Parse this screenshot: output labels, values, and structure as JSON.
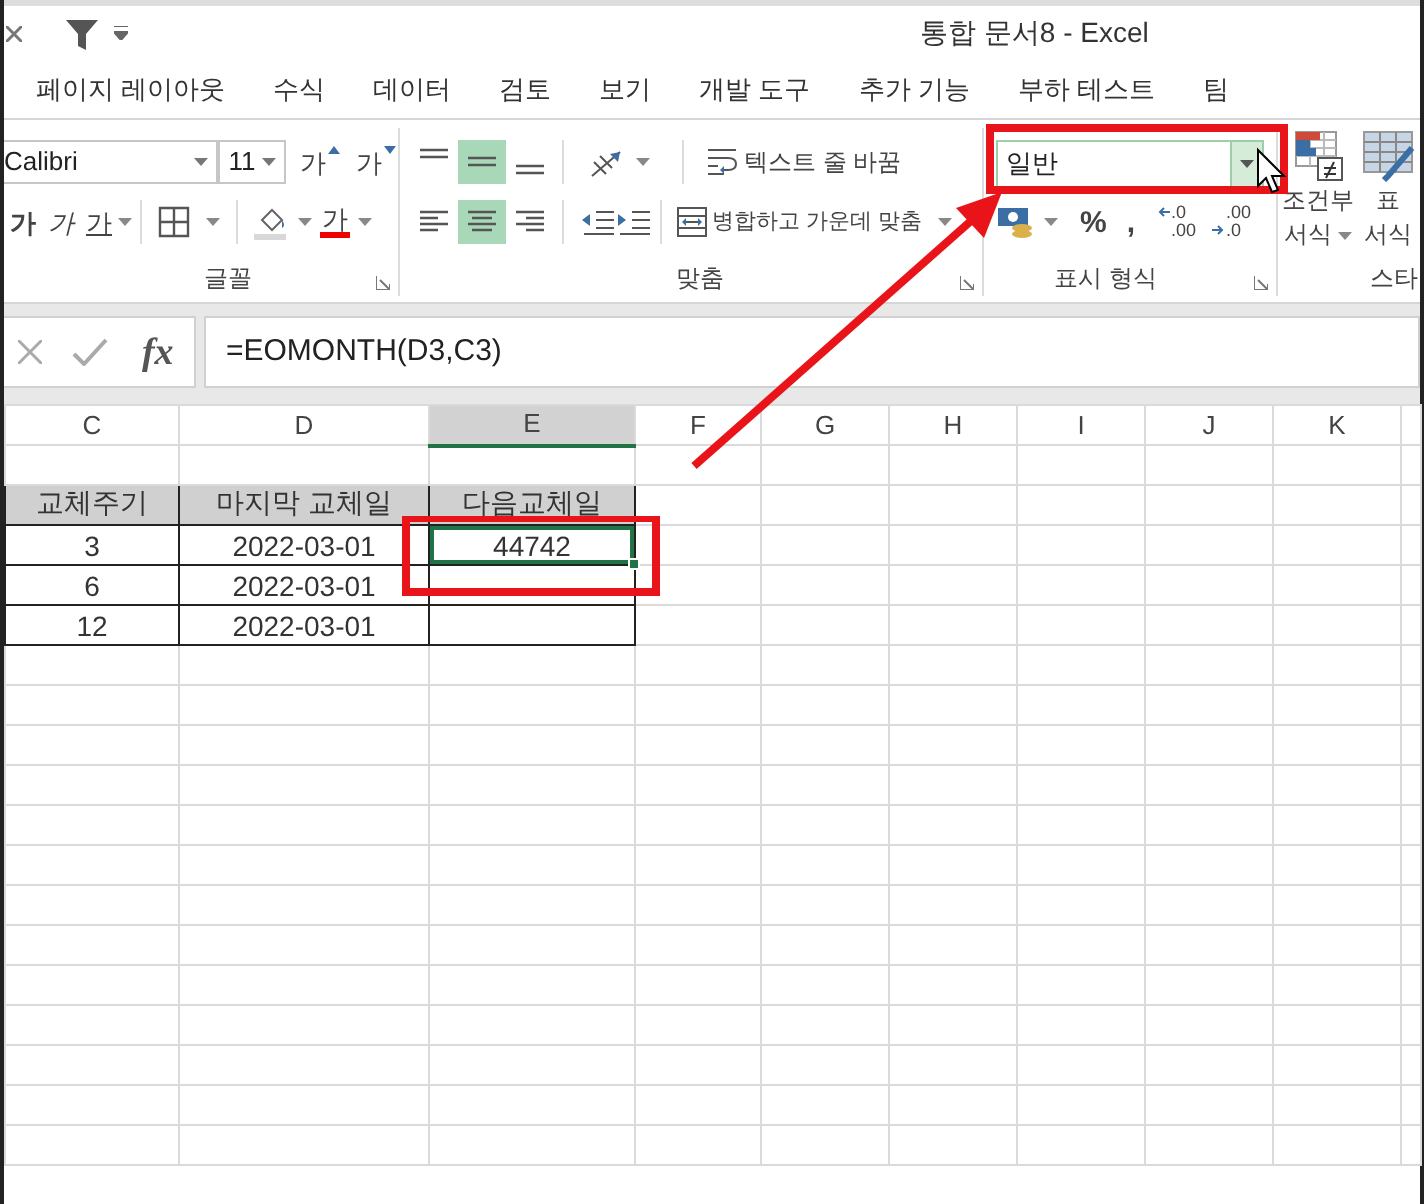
{
  "window": {
    "title": "통합 문서8 - Excel"
  },
  "ribbon_tabs": [
    {
      "label": "페이지 레이아웃"
    },
    {
      "label": "수식"
    },
    {
      "label": "데이터"
    },
    {
      "label": "검토"
    },
    {
      "label": "보기"
    },
    {
      "label": "개발 도구"
    },
    {
      "label": "추가 기능"
    },
    {
      "label": "부하 테스트"
    },
    {
      "label": "팀"
    }
  ],
  "font_group": {
    "label": "글꼴",
    "font_name": "Calibri",
    "font_size": "11",
    "grow_button": "가",
    "shrink_button": "가",
    "style_buttons": [
      "가",
      "가",
      "가"
    ],
    "font_color_button": "가"
  },
  "alignment_group": {
    "label": "맞춤",
    "vertical_align": [
      {
        "selected": false
      },
      {
        "selected": true
      },
      {
        "selected": false
      }
    ],
    "horizontal_align": [
      {
        "selected": false
      },
      {
        "selected": true
      },
      {
        "selected": false
      }
    ],
    "wrap_text": "텍스트 줄 바꿈",
    "merge_center": "병합하고 가운데 맞춤"
  },
  "number_group": {
    "label": "표시 형식",
    "format": "일반",
    "percent_button": "%",
    "comma_button": ",",
    "decimal_buttons": [
      {
        "top": ".0",
        "bottom": ".00"
      },
      {
        "top": ".00",
        "bottom": ".0"
      }
    ]
  },
  "styles_group": {
    "label": "스타",
    "buttons": [
      {
        "lines": [
          "조건부",
          "서식"
        ]
      },
      {
        "lines": [
          "표",
          "서식"
        ]
      }
    ]
  },
  "formula_bar": {
    "function_button": "fx",
    "formula": "=EOMONTH(D3,C3)"
  },
  "sheet": {
    "columns": [
      {
        "label": "C",
        "selected": false
      },
      {
        "label": "D",
        "selected": false
      },
      {
        "label": "E",
        "selected": true
      },
      {
        "label": "F",
        "selected": false
      },
      {
        "label": "G",
        "selected": false
      },
      {
        "label": "H",
        "selected": false
      },
      {
        "label": "I",
        "selected": false
      },
      {
        "label": "J",
        "selected": false
      },
      {
        "label": "K",
        "selected": false
      }
    ],
    "rows": [
      {
        "kind": "header",
        "cells": [
          {
            "text": "교체주기",
            "selected": false
          },
          {
            "text": "마지막 교체일",
            "selected": false
          },
          {
            "text": "다음교체일",
            "selected": false
          }
        ]
      },
      {
        "kind": "data",
        "cells": [
          {
            "text": "3",
            "selected": false
          },
          {
            "text": "2022-03-01",
            "selected": false
          },
          {
            "text": "44742",
            "selected": true
          }
        ]
      },
      {
        "kind": "data",
        "cells": [
          {
            "text": "6",
            "selected": false
          },
          {
            "text": "2022-03-01",
            "selected": false
          }
        ]
      },
      {
        "kind": "data",
        "cells": [
          {
            "text": "12",
            "selected": false
          },
          {
            "text": "2022-03-01",
            "selected": false
          }
        ]
      }
    ]
  }
}
